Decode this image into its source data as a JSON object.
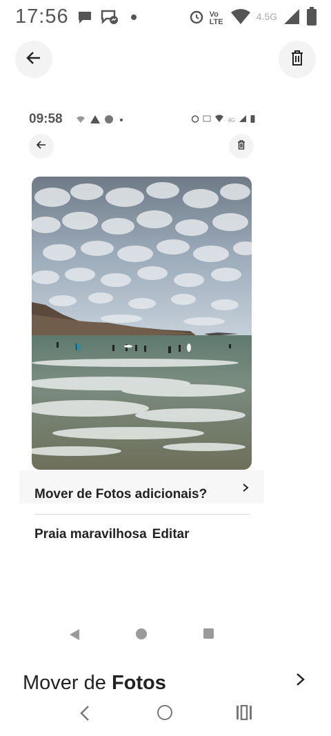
{
  "status_bar": {
    "time": "17:56",
    "network": "4.5G",
    "volte": "Vo LTE",
    "icons": [
      "chat-bubble-icon",
      "messenger-icon",
      "dot-icon",
      "alarm-icon",
      "volte-icon",
      "wifi-icon",
      "signal-icon",
      "battery-icon"
    ]
  },
  "header": {
    "back_icon": "arrow-left-icon",
    "delete_icon": "trash-icon"
  },
  "inner_screen": {
    "status_bar": {
      "time": "09:58",
      "network": "4G"
    },
    "photo_subject": "beach-photo",
    "move_row": {
      "label": "Mover de Fotos adicionais?"
    },
    "caption": {
      "text": "Praia maravilhosa",
      "edit_label": "Editar"
    },
    "nav_icons": [
      "triangle-back-icon",
      "circle-home-icon",
      "square-recents-icon"
    ]
  },
  "sheet": {
    "title_prefix": "Mover de",
    "title_strong": "Fotos"
  },
  "colors": {
    "background": "#ffffff",
    "button_bg": "#f3f3f3",
    "text": "#222222",
    "muted": "#9a9a9a"
  }
}
